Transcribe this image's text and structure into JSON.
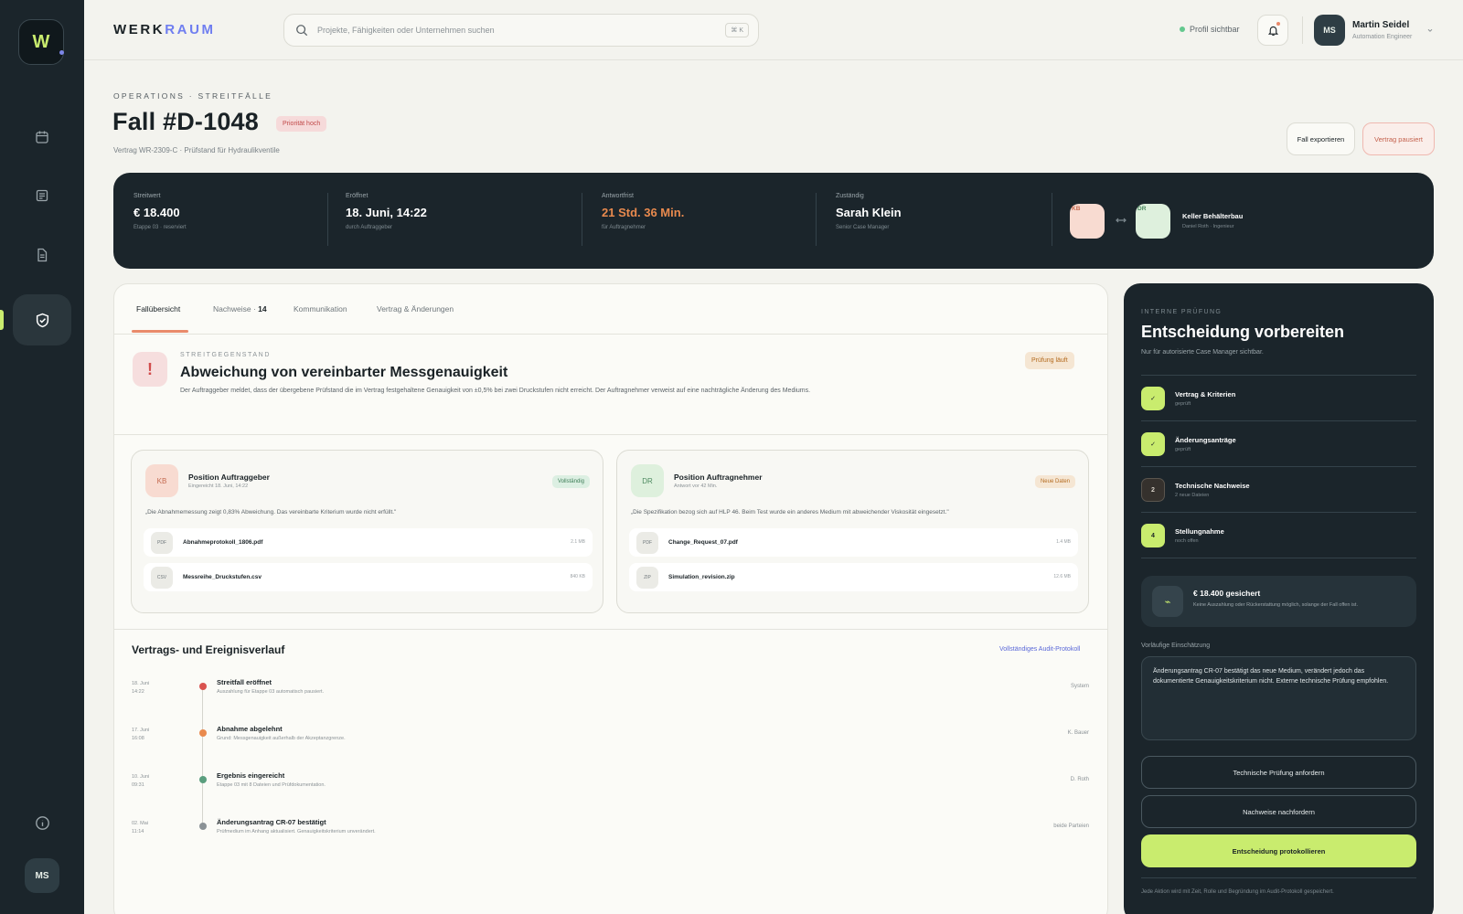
{
  "sidebar": {
    "logo_letter": "W",
    "user_initials": "MS"
  },
  "header": {
    "brand_part1": "WERK",
    "brand_part2": "RAUM",
    "search_placeholder": "Projekte, Fähigkeiten oder Unternehmen suchen",
    "search_shortcut": "⌘ K",
    "profile_status": "Profil sichtbar",
    "user": {
      "initials": "MS",
      "name": "Martin Seidel",
      "role": "Automation Engineer"
    }
  },
  "page": {
    "breadcrumb": "OPERATIONS · STREITFÄLLE",
    "title": "Fall #D-1048",
    "priority": "Priorität hoch",
    "subtitle": "Vertrag WR-2309-C · Prüfstand für Hydraulikventile",
    "export_label": "Fall exportieren",
    "pause_label": "Vertrag pausiert"
  },
  "stats": {
    "value": {
      "label": "Streitwert",
      "value": "€ 18.400",
      "sub": "Etappe 03 · reserviert"
    },
    "opened": {
      "label": "Eröffnet",
      "value": "18. Juni, 14:22",
      "sub": "durch Auftraggeber"
    },
    "deadline": {
      "label": "Antwortfrist",
      "value": "21 Std. 36 Min.",
      "sub": "für Auftragnehmer"
    },
    "owner": {
      "label": "Zuständig",
      "value": "Sarah Klein",
      "sub": "Senior Case Manager"
    },
    "parties": {
      "a_initials": "KB",
      "b_initials": "DR",
      "name": "Keller Behälterbau",
      "contact": "Daniel Roth · Ingenieur"
    }
  },
  "tabs": [
    {
      "label": "Fallübersicht",
      "count": ""
    },
    {
      "label": "Nachweise",
      "count": "14"
    },
    {
      "label": "Kommunikation",
      "count": ""
    },
    {
      "label": "Vertrag & Änderungen",
      "count": ""
    }
  ],
  "issue": {
    "label": "STREITGEGENSTAND",
    "title": "Abweichung von vereinbarter Messgenauigkeit",
    "description": "Der Auftraggeber meldet, dass der übergebene Prüfstand die im Vertrag festgehaltene Genauigkeit von ±0,5% bei zwei Druckstufen nicht erreicht. Der Auftragnehmer verweist auf eine nachträgliche Änderung des Mediums.",
    "status": "Prüfung läuft"
  },
  "positions": [
    {
      "initials": "KB",
      "title": "Position Auftraggeber",
      "meta": "Eingereicht 18. Juni, 14:22",
      "badge": "Vollständig",
      "quote": "„Die Abnahmemessung zeigt 0,83% Abweichung. Das vereinbarte Kriterium wurde nicht erfüllt.\"",
      "files": [
        {
          "ext": "PDF",
          "name": "Abnahmeprotokoll_1806.pdf",
          "size": "2.1 MB"
        },
        {
          "ext": "CSV",
          "name": "Messreihe_Druckstufen.csv",
          "size": "840 KB"
        }
      ]
    },
    {
      "initials": "DR",
      "title": "Position Auftragnehmer",
      "meta": "Antwort vor 42 Min.",
      "badge": "Neue Daten",
      "quote": "„Die Spezifikation bezog sich auf HLP 46. Beim Test wurde ein anderes Medium mit abweichender Viskosität eingesetzt.\"",
      "files": [
        {
          "ext": "PDF",
          "name": "Change_Request_07.pdf",
          "size": "1.4 MB"
        },
        {
          "ext": "ZIP",
          "name": "Simulation_revision.zip",
          "size": "12.6 MB"
        }
      ]
    }
  ],
  "timeline": {
    "title": "Vertrags- und Ereignisverlauf",
    "link": "Vollständiges Audit-Protokoll",
    "events": [
      {
        "date": "18. Juni",
        "time": "14:22",
        "title": "Streitfall eröffnet",
        "desc": "Auszahlung für Etappe 03 automatisch pausiert.",
        "actor": "System",
        "color": "#d9534f"
      },
      {
        "date": "17. Juni",
        "time": "16:08",
        "title": "Abnahme abgelehnt",
        "desc": "Grund: Messgenauigkeit außerhalb der Akzeptanzgrenze.",
        "actor": "K. Bauer",
        "color": "#e98a4e"
      },
      {
        "date": "10. Juni",
        "time": "09:31",
        "title": "Ergebnis eingereicht",
        "desc": "Etappe 03 mit 8 Dateien und Prüfdokumentation.",
        "actor": "D. Roth",
        "color": "#5a9e7e"
      },
      {
        "date": "02. Mai",
        "time": "11:14",
        "title": "Änderungsantrag CR-07 bestätigt",
        "desc": "Prüfmedium im Anhang aktualisiert. Genauigkeitskriterium unverändert.",
        "actor": "beide Parteien",
        "color": "#8b9296"
      }
    ]
  },
  "review": {
    "label": "INTERNE PRÜFUNG",
    "title": "Entscheidung vorbereiten",
    "subtitle": "Nur für autorisierte Case Manager sichtbar.",
    "steps": [
      {
        "mark": "✓",
        "title": "Vertrag & Kriterien",
        "sub": "geprüft"
      },
      {
        "mark": "✓",
        "title": "Änderungsanträge",
        "sub": "geprüft"
      },
      {
        "mark": "2",
        "title": "Technische Nachweise",
        "sub": "2 neue Dateien"
      },
      {
        "mark": "4",
        "title": "Stellungnahme",
        "sub": "noch offen"
      }
    ],
    "secured_title": "€ 18.400 gesichert",
    "secured_sub": "Keine Auszahlung oder Rückerstattung möglich, solange der Fall offen ist.",
    "assessment_label": "Vorläufige Einschätzung",
    "assessment_text": "Änderungsantrag CR-07 bestätigt das neue Medium, verändert jedoch das dokumentierte Genauigkeitskriterium nicht. Externe technische Prüfung empfohlen.",
    "btn_tech": "Technische Prüfung anfordern",
    "btn_evidence": "Nachweise nachfordern",
    "btn_log": "Entscheidung protokollieren",
    "footer": "Jede Aktion wird mit Zeit, Rolle und Begründung im Audit-Protokoll gespeichert."
  },
  "colors": {
    "accent_lime": "#c9ec6e",
    "dark": "#1b252b",
    "danger": "#d14c4c",
    "warning": "#e98a6b",
    "link": "#5a68d8"
  }
}
